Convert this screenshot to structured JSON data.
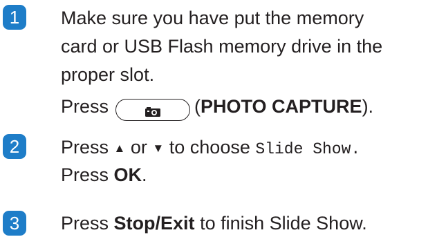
{
  "steps": [
    {
      "number": "1",
      "line1": "Make sure you have put the memory",
      "line2": "card or USB Flash memory drive in the",
      "line3": "proper slot.",
      "press_word": "Press",
      "button_label": "(PHOTO CAPTURE).",
      "button_label_parts": {
        "open": "(",
        "bold": "PHOTO CAPTURE",
        "close": ")."
      },
      "button_icon": "camera-icon"
    },
    {
      "number": "2",
      "press_word": "Press",
      "up_arrow": "▲",
      "or_word": "or",
      "down_arrow": "▼",
      "to_choose": "to choose",
      "menu_value": "Slide Show.",
      "press_ok_prefix": "Press",
      "ok_label": "OK",
      "ok_suffix": "."
    },
    {
      "number": "3",
      "press_word": "Press",
      "stop_label": "Stop/Exit",
      "finish_text": "to finish Slide Show."
    }
  ],
  "colors": {
    "badge_blue": "#1e7dc8",
    "text": "#231f20"
  }
}
